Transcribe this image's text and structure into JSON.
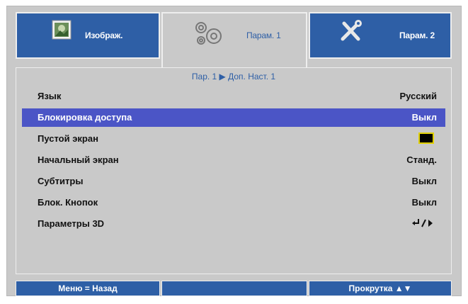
{
  "tabs": [
    {
      "label": "Изображ.",
      "icon": "image-icon",
      "active": false
    },
    {
      "label": "Парам. 1",
      "icon": "gears-icon",
      "active": true
    },
    {
      "label": "Парам. 2",
      "icon": "tools-icon",
      "active": false
    }
  ],
  "breadcrumb": "Пар. 1 ▶ Доп. Наст. 1",
  "settings": [
    {
      "label": "Язык",
      "value": "Русский"
    },
    {
      "label": "Блокировка доступа",
      "value": "Выкл"
    },
    {
      "label": "Пустой экран",
      "value": "",
      "swatch": "black"
    },
    {
      "label": "Начальный экран",
      "value": "Станд."
    },
    {
      "label": "Субтитры",
      "value": "Выкл"
    },
    {
      "label": "Блок. Кнопок",
      "value": "Выкл"
    },
    {
      "label": "Параметры 3D",
      "value": "",
      "control": "enter-arrow-icon"
    }
  ],
  "footer": {
    "back": "Меню = Назад",
    "middle": "",
    "scroll": "Прокрутка ▲▼"
  },
  "colors": {
    "accent": "#2e5fa6",
    "selection": "#4b55c6",
    "panel": "#c9c9c9"
  }
}
